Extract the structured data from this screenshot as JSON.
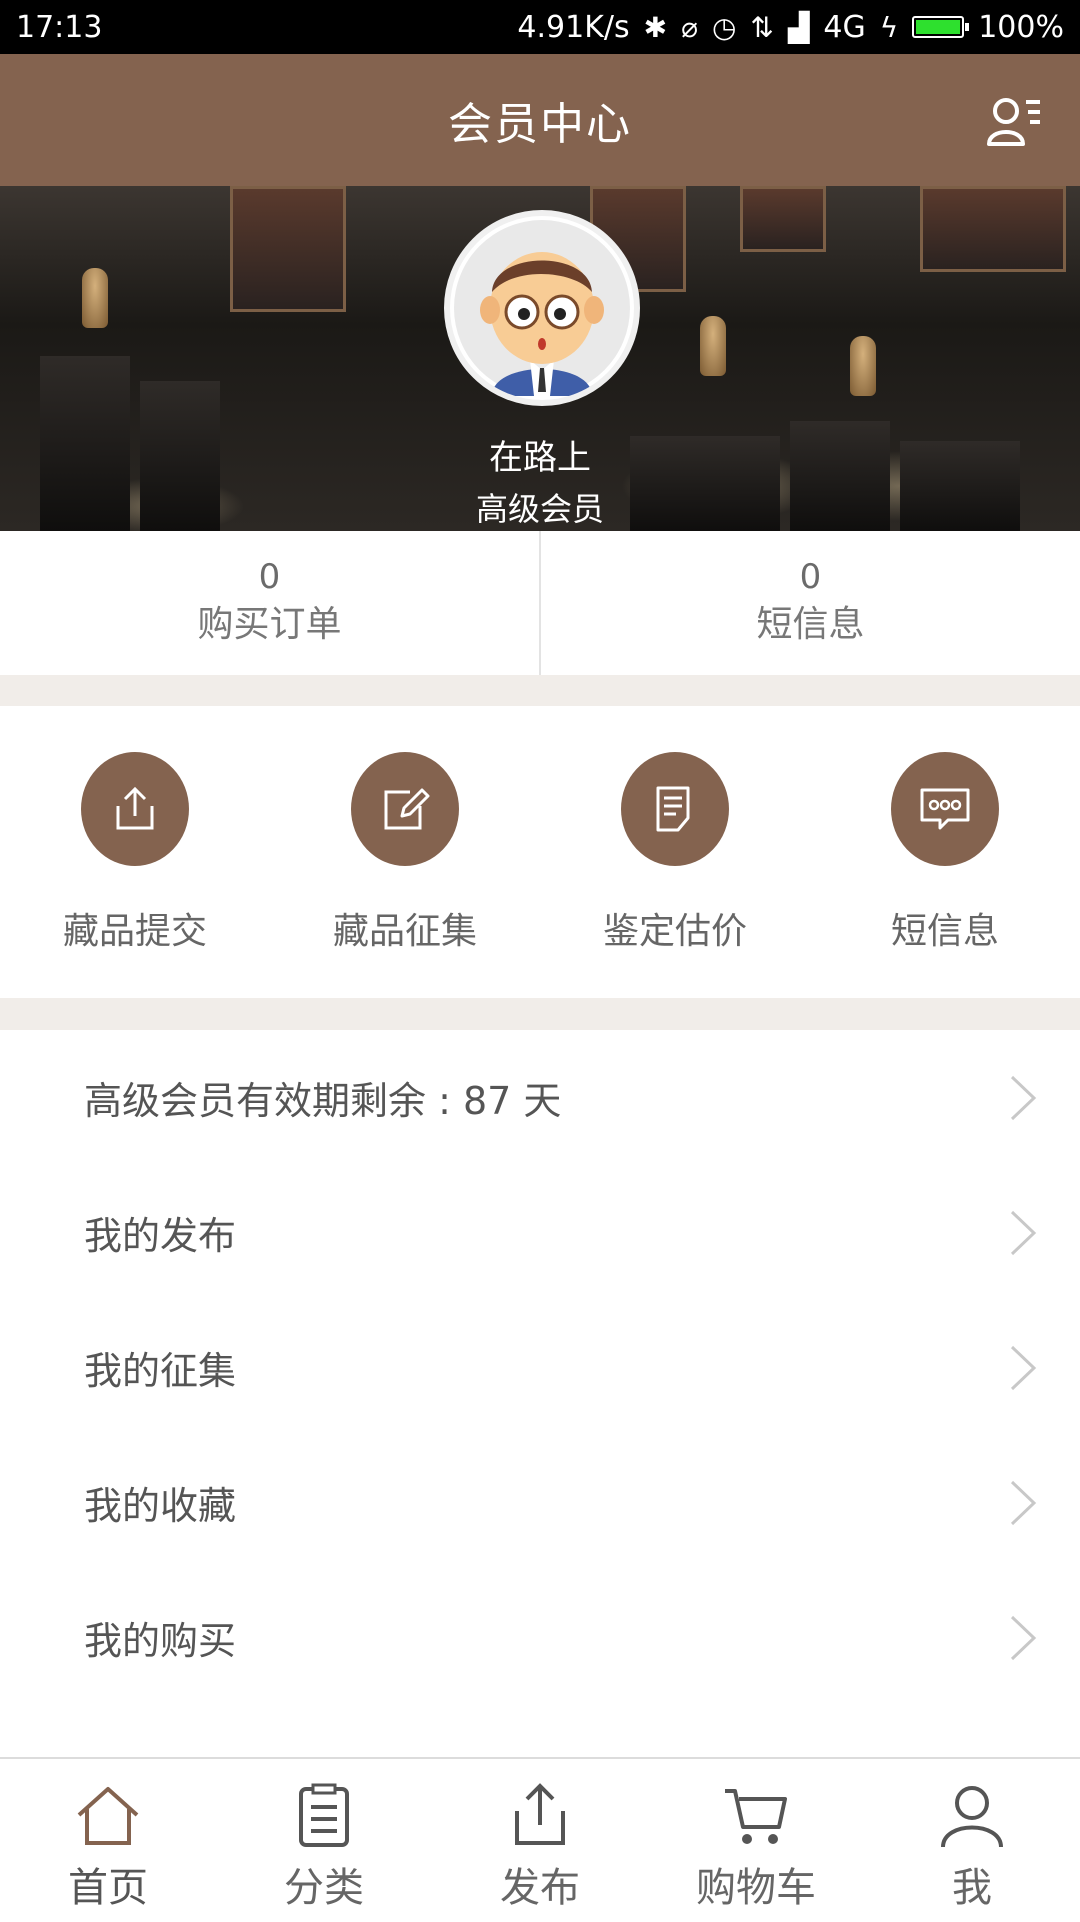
{
  "status_bar": {
    "time": "17:13",
    "net_speed": "4.91K/s",
    "network": "4G",
    "battery": "100%"
  },
  "header": {
    "title": "会员中心"
  },
  "profile": {
    "name": "在路上",
    "level": "高级会员"
  },
  "stats": [
    {
      "value": "0",
      "label": "购买订单"
    },
    {
      "value": "0",
      "label": "短信息"
    }
  ],
  "actions": [
    {
      "label": "藏品提交",
      "icon": "upload-icon"
    },
    {
      "label": "藏品征集",
      "icon": "edit-icon"
    },
    {
      "label": "鉴定估价",
      "icon": "document-icon"
    },
    {
      "label": "短信息",
      "icon": "message-icon"
    }
  ],
  "menu": [
    {
      "label": "高级会员有效期剩余 : 87 天"
    },
    {
      "label": "我的发布"
    },
    {
      "label": "我的征集"
    },
    {
      "label": "我的收藏"
    },
    {
      "label": "我的购买"
    }
  ],
  "bottom_nav": [
    {
      "label": "首页",
      "icon": "home-icon",
      "active": true
    },
    {
      "label": "分类",
      "icon": "list-icon",
      "active": false
    },
    {
      "label": "发布",
      "icon": "upload-icon",
      "active": false
    },
    {
      "label": "购物车",
      "icon": "cart-icon",
      "active": false
    },
    {
      "label": "我",
      "icon": "person-icon",
      "active": false
    }
  ],
  "colors": {
    "brand": "#84634f",
    "status_bar": "#000000",
    "battery": "#2ee02e"
  }
}
